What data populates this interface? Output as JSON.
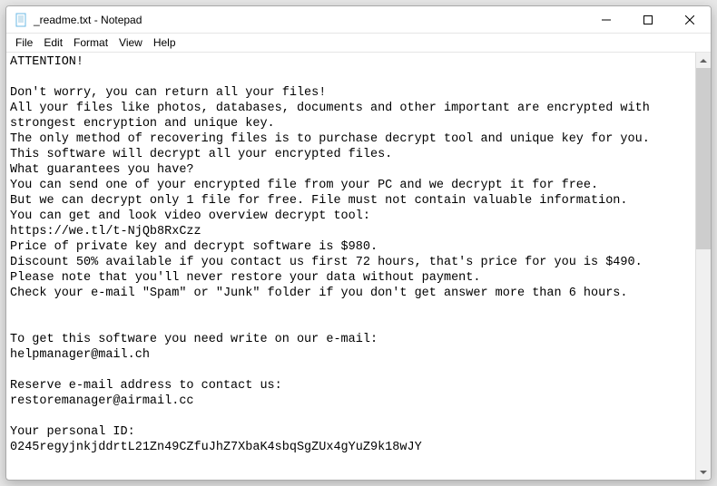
{
  "titlebar": {
    "title": "_readme.txt - Notepad"
  },
  "menubar": {
    "file": "File",
    "edit": "Edit",
    "format": "Format",
    "view": "View",
    "help": "Help"
  },
  "content": {
    "text": "ATTENTION!\n\nDon't worry, you can return all your files!\nAll your files like photos, databases, documents and other important are encrypted with strongest encryption and unique key.\nThe only method of recovering files is to purchase decrypt tool and unique key for you.\nThis software will decrypt all your encrypted files.\nWhat guarantees you have?\nYou can send one of your encrypted file from your PC and we decrypt it for free.\nBut we can decrypt only 1 file for free. File must not contain valuable information.\nYou can get and look video overview decrypt tool:\nhttps://we.tl/t-NjQb8RxCzz\nPrice of private key and decrypt software is $980.\nDiscount 50% available if you contact us first 72 hours, that's price for you is $490.\nPlease note that you'll never restore your data without payment.\nCheck your e-mail \"Spam\" or \"Junk\" folder if you don't get answer more than 6 hours.\n\n\nTo get this software you need write on our e-mail:\nhelpmanager@mail.ch\n\nReserve e-mail address to contact us:\nrestoremanager@airmail.cc\n\nYour personal ID:\n0245regyjnkjddrtL21Zn49CZfuJhZ7XbaK4sbqSgZUx4gYuZ9k18wJY"
  }
}
